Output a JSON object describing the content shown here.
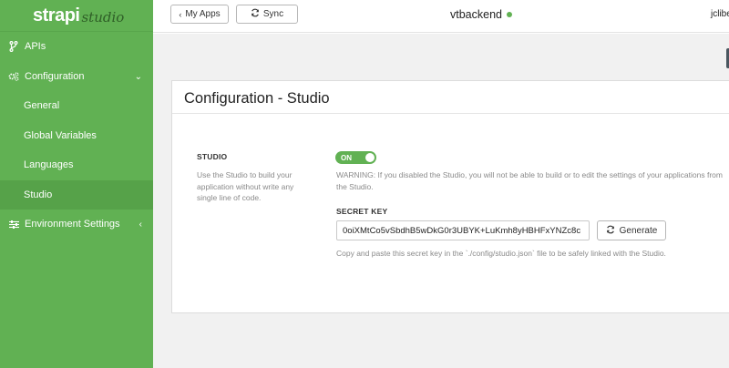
{
  "brand": {
    "name": "strapi",
    "sub": "studio"
  },
  "sidebar": {
    "items": [
      {
        "label": "APIs",
        "icon": "branch-icon"
      },
      {
        "label": "Configuration",
        "icon": "cogs-icon",
        "chevron": "⌄"
      },
      {
        "label": "General"
      },
      {
        "label": "Global Variables"
      },
      {
        "label": "Languages"
      },
      {
        "label": "Studio"
      },
      {
        "label": "Environment Settings",
        "icon": "sliders-icon",
        "chevron": "‹"
      }
    ]
  },
  "header": {
    "my_apps": "My Apps",
    "sync": "Sync",
    "app_name": "vtbackend",
    "status_color": "#61b153",
    "user": "jclibe"
  },
  "page": {
    "title": "Configuration - Studio",
    "studio_label": "STUDIO",
    "studio_desc": "Use the Studio to build your application without write any single line of code.",
    "toggle_label": "ON",
    "warning": "WARNING: If you disabled the Studio, you will not be able to build or to edit the settings of your applications from the Studio.",
    "secret_label": "SECRET KEY",
    "secret_value": "0oiXMtCo5vSbdhB5wDkG0r3UBYK+LuKmh8yHBHFxYNZc8c",
    "generate": "Generate",
    "hint": "Copy and paste this secret key in the `./config/studio.json` file to be safely linked with the Studio."
  },
  "colors": {
    "accent": "#61b153",
    "sidebar_bg": "#61b153"
  }
}
